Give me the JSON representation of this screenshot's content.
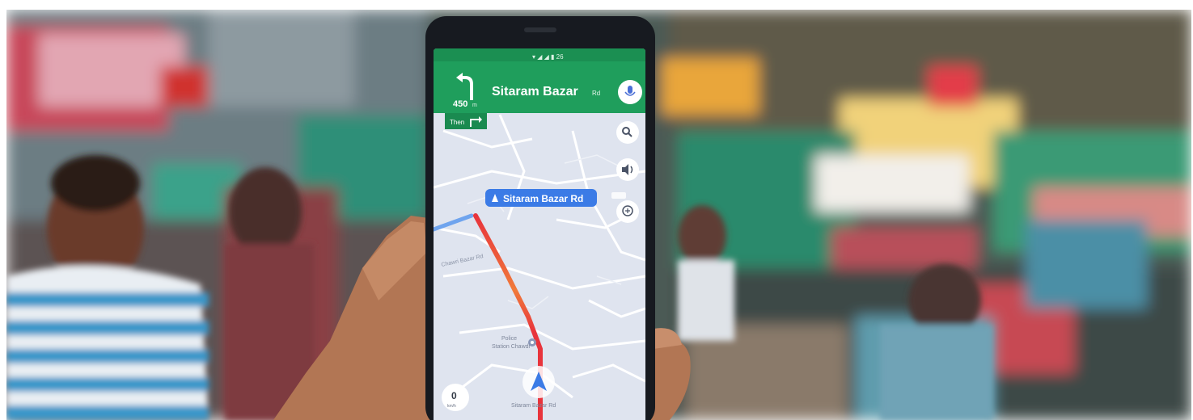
{
  "navigation": {
    "distance": "450",
    "distance_unit": "m",
    "street": "Sitaram Bazar",
    "street_suffix": "Rd",
    "then_label": "Then",
    "route_label": "Sitaram Bazar Rd",
    "map_label_road": "Chawri Bazar Rd",
    "map_label_poi_line1": "Police",
    "map_label_poi_line2": "Station Chawdi",
    "bottom_road": "Sitaram Bazar Rd",
    "speed_value": "0",
    "speed_unit": "km/h"
  },
  "icons": [
    "turn-left-icon",
    "mic-icon",
    "turn-right-icon",
    "search-icon",
    "speaker-icon",
    "add-comment-icon",
    "nav-arrow-icon",
    "poi-pin-icon"
  ],
  "colors": {
    "nav_header": "#1f9e5c",
    "route_blue": "#3b7be6",
    "route_red": "#e8343c",
    "map_bg": "#dfe4ef"
  }
}
